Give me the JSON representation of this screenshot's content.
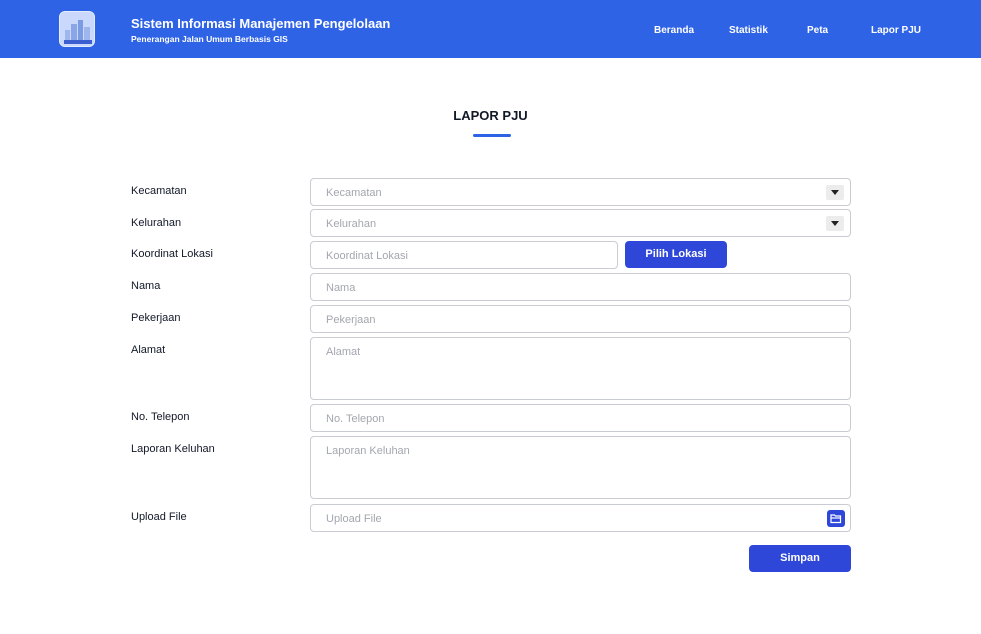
{
  "header": {
    "title": "Sistem Informasi Manajemen Pengelolaan",
    "subtitle": "Penerangan Jalan Umum Berbasis GIS",
    "logo_icon": "city-skyline-icon",
    "nav": [
      {
        "label": "Beranda"
      },
      {
        "label": "Statistik"
      },
      {
        "label": "Peta"
      },
      {
        "label": "Lapor PJU"
      }
    ]
  },
  "page": {
    "title": "LAPOR PJU",
    "accent_color": "#2f63e6",
    "button_color": "#2f47d8"
  },
  "form": {
    "kecamatan": {
      "label": "Kecamatan",
      "placeholder": "Kecamatan"
    },
    "kelurahan": {
      "label": "Kelurahan",
      "placeholder": "Kelurahan"
    },
    "koordinat": {
      "label": "Koordinat Lokasi",
      "placeholder": "Koordinat Lokasi",
      "button": "Pilih Lokasi"
    },
    "nama": {
      "label": "Nama",
      "placeholder": "Nama"
    },
    "pekerjaan": {
      "label": "Pekerjaan",
      "placeholder": "Pekerjaan"
    },
    "alamat": {
      "label": "Alamat",
      "placeholder": "Alamat"
    },
    "telepon": {
      "label": "No. Telepon",
      "placeholder": "No. Telepon"
    },
    "laporan": {
      "label": "Laporan Keluhan",
      "placeholder": "Laporan Keluhan"
    },
    "upload": {
      "label": "Upload File",
      "placeholder": "Upload File",
      "icon": "folder-open-icon"
    },
    "submit_label": "Simpan"
  }
}
